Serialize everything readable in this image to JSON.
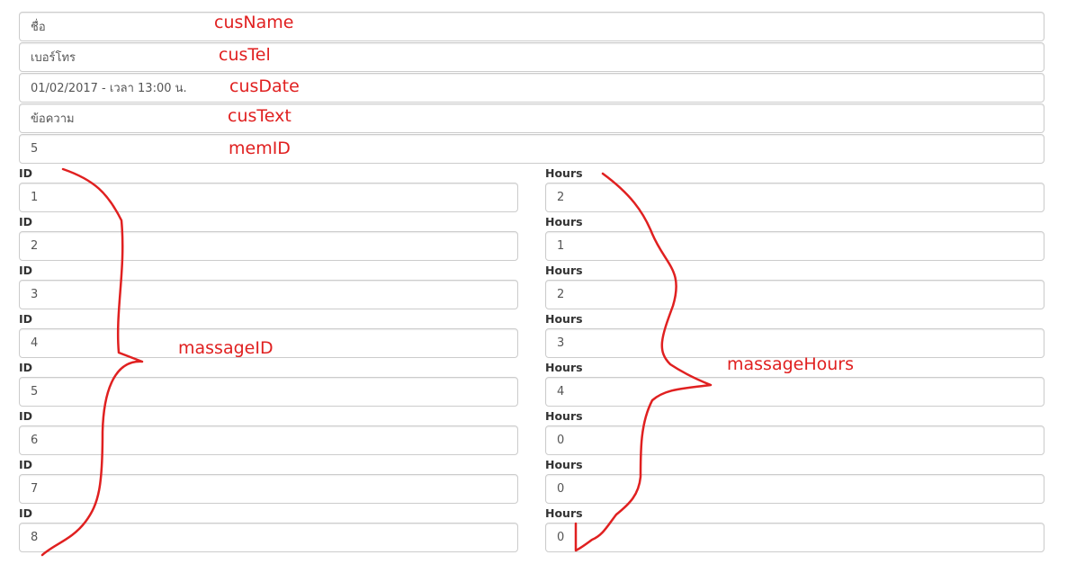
{
  "top_fields": [
    {
      "value": "ชื่อ",
      "annotation": "cusName"
    },
    {
      "value": "เบอร์โทร",
      "annotation": "cusTel"
    },
    {
      "value": "01/02/2017 - เวลา 13:00 น.",
      "annotation": "cusDate"
    },
    {
      "value": "ข้อความ",
      "annotation": "cusText"
    },
    {
      "value": "5",
      "annotation": "memID"
    }
  ],
  "left_label": "ID",
  "right_label": "Hours",
  "rows": [
    {
      "id": "1",
      "hours": "2"
    },
    {
      "id": "2",
      "hours": "1"
    },
    {
      "id": "3",
      "hours": "2"
    },
    {
      "id": "4",
      "hours": "3"
    },
    {
      "id": "5",
      "hours": "4"
    },
    {
      "id": "6",
      "hours": "0"
    },
    {
      "id": "7",
      "hours": "0"
    },
    {
      "id": "8",
      "hours": "0"
    }
  ],
  "annotations": {
    "massage_id": "massageID",
    "massage_hours": "massageHours",
    "color": "#e02020"
  }
}
